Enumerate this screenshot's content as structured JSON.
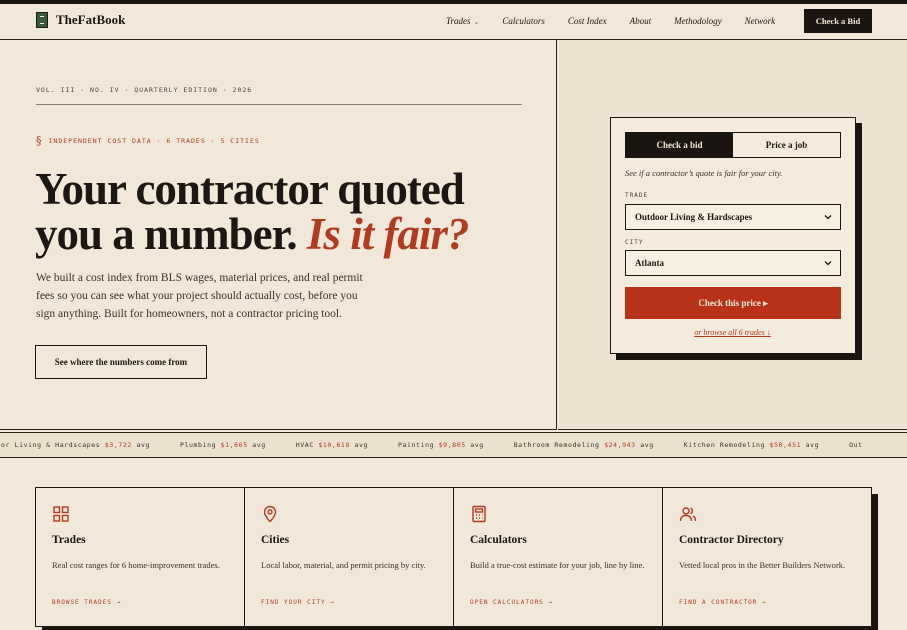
{
  "brand": {
    "name": "TheFatBook",
    "icon": "book-icon"
  },
  "nav": {
    "links": [
      {
        "label": "Trades",
        "has_dropdown": true
      },
      {
        "label": "Calculators"
      },
      {
        "label": "Cost Index"
      },
      {
        "label": "About"
      },
      {
        "label": "Methodology"
      },
      {
        "label": "Network"
      }
    ],
    "cta": "Check a Bid",
    "dropdown_caret": "⌄"
  },
  "hero": {
    "edition": "VOL. III · NO. IV · QUARTERLY EDITION · 2026",
    "tagline_icon": "§",
    "tagline": "INDEPENDENT COST DATA · 6 TRADES · 5 CITIES",
    "headline_line1": "Your contractor quoted",
    "headline_line2": "you a number.",
    "headline_accent": "Is it fair?",
    "lede": "We built a cost index from BLS wages, material prices, and real permit fees so you can see what your project should actually cost, before you sign anything. Built for homeowners, not a contractor pricing tool.",
    "button": "See where the numbers come from"
  },
  "bid_card": {
    "tabs": [
      {
        "label": "Check a bid",
        "active": true
      },
      {
        "label": "Price a job",
        "active": false
      }
    ],
    "description": "See if a contractor’s quote is fair for your city.",
    "trade_label": "TRADE",
    "trade_value": "Outdoor Living & Hardscapes",
    "city_label": "CITY",
    "city_value": "Atlanta",
    "submit": "Check this price ▸",
    "browse": "or browse all 6 trades ↓"
  },
  "ticker": {
    "items": [
      {
        "name": "door Living & Hardscapes",
        "value": "$3,722",
        "suffix": "avg"
      },
      {
        "name": "Plumbing",
        "value": "$1,665",
        "suffix": "avg"
      },
      {
        "name": "HVAC",
        "value": "$10,618",
        "suffix": "avg"
      },
      {
        "name": "Painting",
        "value": "$9,805",
        "suffix": "avg"
      },
      {
        "name": "Bathroom Remodeling",
        "value": "$24,943",
        "suffix": "avg"
      },
      {
        "name": "Kitchen Remodeling",
        "value": "$50,451",
        "suffix": "avg"
      },
      {
        "name": "Out",
        "value": "",
        "suffix": ""
      }
    ]
  },
  "features": [
    {
      "icon": "grid-icon",
      "title": "Trades",
      "desc": "Real cost ranges for 6 home-improvement trades.",
      "link": "BROWSE TRADES →"
    },
    {
      "icon": "map-pin-icon",
      "title": "Cities",
      "desc": "Local labor, material, and permit pricing by city.",
      "link": "FIND YOUR CITY →"
    },
    {
      "icon": "calculator-icon",
      "title": "Calculators",
      "desc": "Build a true-cost estimate for your job, line by line.",
      "link": "OPEN CALCULATORS →"
    },
    {
      "icon": "users-icon",
      "title": "Contractor Directory",
      "desc": "Vetted local pros in the Better Builders Network.",
      "link": "FIND A CONTRACTOR →"
    }
  ],
  "colors": {
    "accent": "#b8321a",
    "ink": "#1c1712",
    "paper": "#f2e8d9"
  }
}
